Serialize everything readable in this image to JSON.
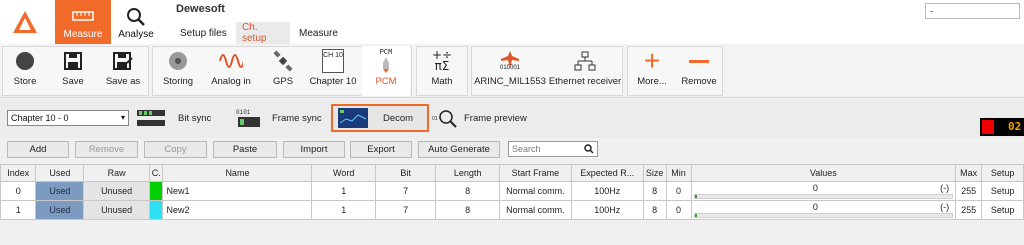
{
  "app": {
    "title": "Dewesoft",
    "window_field": "-"
  },
  "top_nav": {
    "measure": "Measure",
    "analyse": "Analyse"
  },
  "sub_tabs": [
    {
      "label": "Setup files"
    },
    {
      "label": "Ch. setup"
    },
    {
      "label": "Measure"
    }
  ],
  "toolbar": {
    "store": "Store",
    "save": "Save",
    "save_as": "Save as",
    "storing": "Storing",
    "analog_in": "Analog in",
    "gps": "GPS",
    "chapter10": "Chapter 10",
    "pcm": "PCM",
    "math": "Math",
    "arinc": "ARINC_MIL1553",
    "ethernet": "Ethernet receiver",
    "more": "More...",
    "remove": "Remove",
    "ch10_icon_text": "CH 10",
    "pcm_icon_text": "PCM",
    "arinc_icon_text": "010001"
  },
  "section": {
    "select_value": "Chapter 10 - 0",
    "bit_sync": "Bit sync",
    "frame_sync": "Frame sync",
    "decom": "Decom",
    "frame_preview": "Frame preview",
    "led_text": "02"
  },
  "actions": {
    "add": "Add",
    "remove": "Remove",
    "copy": "Copy",
    "paste": "Paste",
    "import": "Import",
    "export": "Export",
    "auto_generate": "Auto Generate",
    "search_placeholder": "Search"
  },
  "table": {
    "headers": [
      "Index",
      "Used",
      "Raw",
      "C.",
      "Name",
      "Word",
      "Bit",
      "Length",
      "Start Frame",
      "Expected R...",
      "Size",
      "Min",
      "Values",
      "Max",
      "Setup"
    ],
    "rows": [
      {
        "index": "0",
        "used": "Used",
        "raw": "Unused",
        "color": "#00d000",
        "name": "New1",
        "word": "1",
        "bit": "7",
        "length": "8",
        "start_frame": "Normal comm.",
        "expected_rate": "100Hz",
        "size": "8",
        "min": "0",
        "value": "0",
        "value_unit": "(-)",
        "value_fill": 0,
        "max": "255",
        "setup": "Setup"
      },
      {
        "index": "1",
        "used": "Used",
        "raw": "Unused",
        "color": "#2ee0f0",
        "name": "New2",
        "word": "1",
        "bit": "7",
        "length": "8",
        "start_frame": "Normal comm.",
        "expected_rate": "100Hz",
        "size": "8",
        "min": "0",
        "value": "0",
        "value_unit": "(-)",
        "value_fill": 0,
        "max": "255",
        "setup": "Setup"
      }
    ]
  },
  "colors": {
    "accent": "#f26a2a",
    "used_bg": "#7d9bc1"
  }
}
